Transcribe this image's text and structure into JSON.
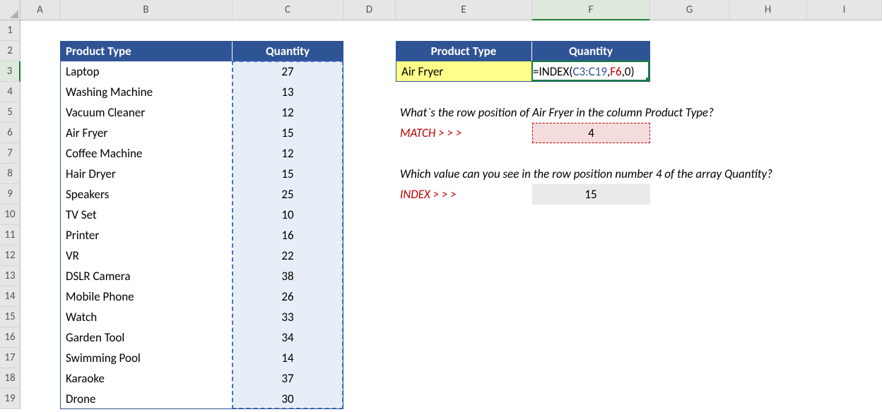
{
  "columns": [
    "A",
    "B",
    "C",
    "D",
    "E",
    "F",
    "G",
    "H",
    "I"
  ],
  "row_count": 19,
  "table": {
    "headers": {
      "product_type": "Product Type",
      "quantity": "Quantity"
    },
    "rows": [
      {
        "name": "Laptop",
        "qty": "27"
      },
      {
        "name": "Washing Machine",
        "qty": "13"
      },
      {
        "name": "Vacuum Cleaner",
        "qty": "12"
      },
      {
        "name": "Air Fryer",
        "qty": "15"
      },
      {
        "name": "Coffee Machine",
        "qty": "12"
      },
      {
        "name": "Hair Dryer",
        "qty": "15"
      },
      {
        "name": "Speakers",
        "qty": "25"
      },
      {
        "name": "TV Set",
        "qty": "10"
      },
      {
        "name": "Printer",
        "qty": "16"
      },
      {
        "name": "VR",
        "qty": "22"
      },
      {
        "name": "DSLR Camera",
        "qty": "38"
      },
      {
        "name": "Mobile Phone",
        "qty": "26"
      },
      {
        "name": "Watch",
        "qty": "33"
      },
      {
        "name": "Garden Tool",
        "qty": "34"
      },
      {
        "name": "Swimming Pool",
        "qty": "14"
      },
      {
        "name": "Karaoke",
        "qty": "37"
      },
      {
        "name": "Drone",
        "qty": "30"
      }
    ]
  },
  "right": {
    "headers": {
      "product_type": "Product Type",
      "quantity": "Quantity"
    },
    "lookup_value": "Air Fryer",
    "formula_prefix": "=INDEX(",
    "formula_range": "C3:C19",
    "formula_comma1": ",",
    "formula_ref": "F6",
    "formula_rest": ",0)",
    "q1": "What`s the row position of Air Fryer in the column Product Type?",
    "match_label": "MATCH > > >",
    "match_value": "4",
    "q2": "Which value can you see in the row position number 4 of the array Quantity?",
    "index_label": "INDEX > > >",
    "index_value": "15"
  },
  "active": {
    "col": "F",
    "row": 3
  }
}
